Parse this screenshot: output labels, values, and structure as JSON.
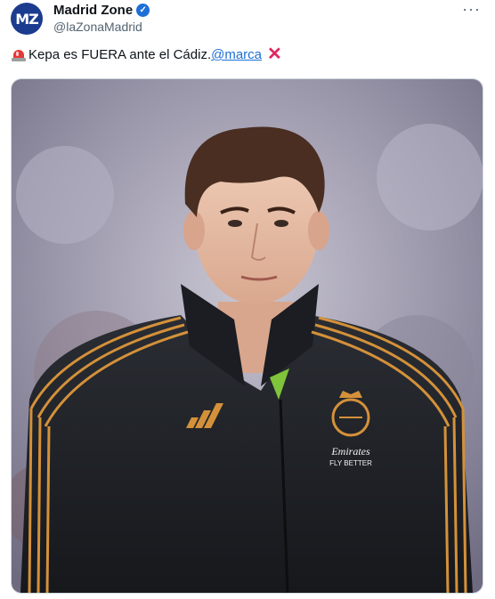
{
  "author": {
    "avatar_text": "MZ",
    "name": "Madrid Zone",
    "handle": "@laZonaMadrid",
    "verified_icon": "verified-badge-icon"
  },
  "more_menu": {
    "label": "···",
    "icon": "more-options-icon"
  },
  "tweet": {
    "text": "Kepa es FUERA ante el Cádiz.",
    "mention": "@marca",
    "leading_icon": "police-light-icon",
    "trailing_icon": "cross-mark-icon",
    "trailing_glyph": "✕"
  },
  "media": {
    "description_icon": "player-photo",
    "jersey_sponsor_line1": "Emirates",
    "jersey_sponsor_line2": "FLY BETTER"
  },
  "colors": {
    "accent": "#1d6fd6",
    "avatar_bg": "#1b3b8f",
    "cross": "#e0245e",
    "jacket": "#1e2126",
    "stripe": "#d4913a"
  }
}
